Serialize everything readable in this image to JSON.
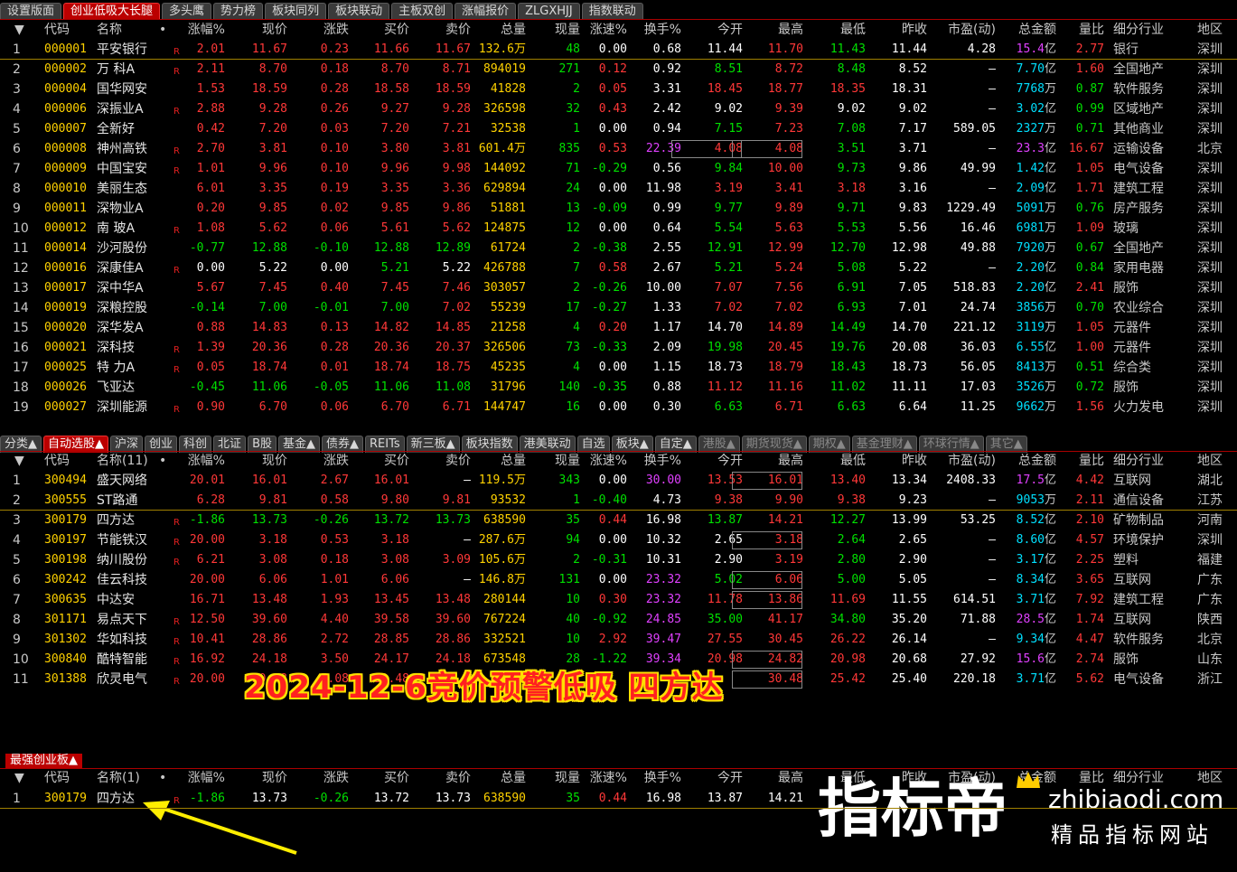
{
  "top_tabs": [
    "设置版面",
    "创业低吸大长腿",
    "多头鹰",
    "势力榜",
    "板块同列",
    "板块联动",
    "主板双创",
    "涨幅报价",
    "ZLGXHJJ",
    "指数联动"
  ],
  "top_tabs_active": 1,
  "mid_tabs": [
    "分类▲",
    "自动选股▲",
    "沪深",
    "创业",
    "科创",
    "北证",
    "B股",
    "基金▲",
    "债券▲",
    "REITs",
    "新三板▲",
    "板块指数",
    "港美联动",
    "自选",
    "板块▲",
    "自定▲",
    "港股▲",
    "期货现货▲",
    "期权▲",
    "基金理财▲",
    "环球行情▲",
    "其它▲"
  ],
  "mid_tabs_active": 1,
  "columns": {
    "sort_arrow": "▼",
    "code": "代码",
    "name": "名称",
    "name_count_2": "名称(11)",
    "name_count_3": "名称(1)",
    "dot": "•",
    "chg_pct": "涨幅%",
    "price": "现价",
    "chg": "涨跌",
    "bid": "买价",
    "ask": "卖价",
    "volume": "总量",
    "cur_vol": "现量",
    "speed": "涨速%",
    "turnover": "换手%",
    "open": "今开",
    "high": "最高",
    "low": "最低",
    "prev_close": "昨收",
    "pe": "市盈(动)",
    "amount": "总金额",
    "vol_ratio": "量比",
    "industry": "细分行业",
    "region": "地区"
  },
  "table1": [
    [
      "1",
      "000001",
      "平安银行",
      "R",
      "2.01",
      "11.67",
      "0.23",
      "11.66",
      "11.67",
      "132.6万",
      "48",
      "0.00",
      "0.68",
      "11.44",
      "11.70",
      "11.43",
      "11.44",
      "4.28",
      "15.4亿",
      "2.77",
      "银行",
      "深圳"
    ],
    [
      "2",
      "000002",
      "万 科A",
      "R",
      "2.11",
      "8.70",
      "0.18",
      "8.70",
      "8.71",
      "894019",
      "271",
      "0.12",
      "0.92",
      "8.51",
      "8.72",
      "8.48",
      "8.52",
      "–",
      "7.70亿",
      "1.60",
      "全国地产",
      "深圳"
    ],
    [
      "3",
      "000004",
      "国华网安",
      "",
      "1.53",
      "18.59",
      "0.28",
      "18.58",
      "18.59",
      "41828",
      "2",
      "0.05",
      "3.31",
      "18.45",
      "18.77",
      "18.35",
      "18.31",
      "–",
      "7768万",
      "0.87",
      "软件服务",
      "深圳"
    ],
    [
      "4",
      "000006",
      "深振业A",
      "R",
      "2.88",
      "9.28",
      "0.26",
      "9.27",
      "9.28",
      "326598",
      "32",
      "0.43",
      "2.42",
      "9.02",
      "9.39",
      "9.02",
      "9.02",
      "–",
      "3.02亿",
      "0.99",
      "区域地产",
      "深圳"
    ],
    [
      "5",
      "000007",
      "全新好",
      "",
      "0.42",
      "7.20",
      "0.03",
      "7.20",
      "7.21",
      "32538",
      "1",
      "0.00",
      "0.94",
      "7.15",
      "7.23",
      "7.08",
      "7.17",
      "589.05",
      "2327万",
      "0.71",
      "其他商业",
      "深圳"
    ],
    [
      "6",
      "000008",
      "神州高铁",
      "R",
      "2.70",
      "3.81",
      "0.10",
      "3.80",
      "3.81",
      "601.4万",
      "835",
      "0.53",
      "22.39",
      "4.08",
      "4.08",
      "3.51",
      "3.71",
      "–",
      "23.3亿",
      "16.67",
      "运输设备",
      "北京"
    ],
    [
      "7",
      "000009",
      "中国宝安",
      "R",
      "1.01",
      "9.96",
      "0.10",
      "9.96",
      "9.98",
      "144092",
      "71",
      "-0.29",
      "0.56",
      "9.84",
      "10.00",
      "9.73",
      "9.86",
      "49.99",
      "1.42亿",
      "1.05",
      "电气设备",
      "深圳"
    ],
    [
      "8",
      "000010",
      "美丽生态",
      "",
      "6.01",
      "3.35",
      "0.19",
      "3.35",
      "3.36",
      "629894",
      "24",
      "0.00",
      "11.98",
      "3.19",
      "3.41",
      "3.18",
      "3.16",
      "–",
      "2.09亿",
      "1.71",
      "建筑工程",
      "深圳"
    ],
    [
      "9",
      "000011",
      "深物业A",
      "",
      "0.20",
      "9.85",
      "0.02",
      "9.85",
      "9.86",
      "51881",
      "13",
      "-0.09",
      "0.99",
      "9.77",
      "9.89",
      "9.71",
      "9.83",
      "1229.49",
      "5091万",
      "0.76",
      "房产服务",
      "深圳"
    ],
    [
      "10",
      "000012",
      "南 玻A",
      "R",
      "1.08",
      "5.62",
      "0.06",
      "5.61",
      "5.62",
      "124875",
      "12",
      "0.00",
      "0.64",
      "5.54",
      "5.63",
      "5.53",
      "5.56",
      "16.46",
      "6981万",
      "1.09",
      "玻璃",
      "深圳"
    ],
    [
      "11",
      "000014",
      "沙河股份",
      "",
      "-0.77",
      "12.88",
      "-0.10",
      "12.88",
      "12.89",
      "61724",
      "2",
      "-0.38",
      "2.55",
      "12.91",
      "12.99",
      "12.70",
      "12.98",
      "49.88",
      "7920万",
      "0.67",
      "全国地产",
      "深圳"
    ],
    [
      "12",
      "000016",
      "深康佳A",
      "R",
      "0.00",
      "5.22",
      "0.00",
      "5.21",
      "5.22",
      "426788",
      "7",
      "0.58",
      "2.67",
      "5.21",
      "5.24",
      "5.08",
      "5.22",
      "–",
      "2.20亿",
      "0.84",
      "家用电器",
      "深圳"
    ],
    [
      "13",
      "000017",
      "深中华A",
      "",
      "5.67",
      "7.45",
      "0.40",
      "7.45",
      "7.46",
      "303057",
      "2",
      "-0.26",
      "10.00",
      "7.07",
      "7.56",
      "6.91",
      "7.05",
      "518.83",
      "2.20亿",
      "2.41",
      "服饰",
      "深圳"
    ],
    [
      "14",
      "000019",
      "深粮控股",
      "",
      "-0.14",
      "7.00",
      "-0.01",
      "7.00",
      "7.02",
      "55239",
      "17",
      "-0.27",
      "1.33",
      "7.02",
      "7.02",
      "6.93",
      "7.01",
      "24.74",
      "3856万",
      "0.70",
      "农业综合",
      "深圳"
    ],
    [
      "15",
      "000020",
      "深华发A",
      "",
      "0.88",
      "14.83",
      "0.13",
      "14.82",
      "14.85",
      "21258",
      "4",
      "0.20",
      "1.17",
      "14.70",
      "14.89",
      "14.49",
      "14.70",
      "221.12",
      "3119万",
      "1.05",
      "元器件",
      "深圳"
    ],
    [
      "16",
      "000021",
      "深科技",
      "R",
      "1.39",
      "20.36",
      "0.28",
      "20.36",
      "20.37",
      "326506",
      "73",
      "-0.33",
      "2.09",
      "19.98",
      "20.45",
      "19.76",
      "20.08",
      "36.03",
      "6.55亿",
      "1.00",
      "元器件",
      "深圳"
    ],
    [
      "17",
      "000025",
      "特 力A",
      "R",
      "0.05",
      "18.74",
      "0.01",
      "18.74",
      "18.75",
      "45235",
      "4",
      "0.00",
      "1.15",
      "18.73",
      "18.79",
      "18.43",
      "18.73",
      "56.05",
      "8413万",
      "0.51",
      "综合类",
      "深圳"
    ],
    [
      "18",
      "000026",
      "飞亚达",
      "",
      "-0.45",
      "11.06",
      "-0.05",
      "11.06",
      "11.08",
      "31796",
      "140",
      "-0.35",
      "0.88",
      "11.12",
      "11.16",
      "11.02",
      "11.11",
      "17.03",
      "3526万",
      "0.72",
      "服饰",
      "深圳"
    ],
    [
      "19",
      "000027",
      "深圳能源",
      "R",
      "0.90",
      "6.70",
      "0.06",
      "6.70",
      "6.71",
      "144747",
      "16",
      "0.00",
      "0.30",
      "6.63",
      "6.71",
      "6.63",
      "6.64",
      "11.25",
      "9662万",
      "1.56",
      "火力发电",
      "深圳"
    ]
  ],
  "table2": [
    [
      "1",
      "300494",
      "盛天网络",
      "",
      "20.01",
      "16.01",
      "2.67",
      "16.01",
      "–",
      "119.5万",
      "343",
      "0.00",
      "30.00",
      "13.53",
      "16.01",
      "13.40",
      "13.34",
      "2408.33",
      "17.5亿",
      "4.42",
      "互联网",
      "湖北"
    ],
    [
      "2",
      "300555",
      "ST路通",
      "",
      "6.28",
      "9.81",
      "0.58",
      "9.80",
      "9.81",
      "93532",
      "1",
      "-0.40",
      "4.73",
      "9.38",
      "9.90",
      "9.38",
      "9.23",
      "–",
      "9053万",
      "2.11",
      "通信设备",
      "江苏"
    ],
    [
      "3",
      "300179",
      "四方达",
      "R",
      "-1.86",
      "13.73",
      "-0.26",
      "13.72",
      "13.73",
      "638590",
      "35",
      "0.44",
      "16.98",
      "13.87",
      "14.21",
      "12.27",
      "13.99",
      "53.25",
      "8.52亿",
      "2.10",
      "矿物制品",
      "河南"
    ],
    [
      "4",
      "300197",
      "节能铁汉",
      "R",
      "20.00",
      "3.18",
      "0.53",
      "3.18",
      "–",
      "287.6万",
      "94",
      "0.00",
      "10.32",
      "2.65",
      "3.18",
      "2.64",
      "2.65",
      "–",
      "8.60亿",
      "4.57",
      "环境保护",
      "深圳"
    ],
    [
      "5",
      "300198",
      "纳川股份",
      "R",
      "6.21",
      "3.08",
      "0.18",
      "3.08",
      "3.09",
      "105.6万",
      "2",
      "-0.31",
      "10.31",
      "2.90",
      "3.19",
      "2.80",
      "2.90",
      "–",
      "3.17亿",
      "2.25",
      "塑料",
      "福建"
    ],
    [
      "6",
      "300242",
      "佳云科技",
      "",
      "20.00",
      "6.06",
      "1.01",
      "6.06",
      "–",
      "146.8万",
      "131",
      "0.00",
      "23.32",
      "5.02",
      "6.06",
      "5.00",
      "5.05",
      "–",
      "8.34亿",
      "3.65",
      "互联网",
      "广东"
    ],
    [
      "7",
      "300635",
      "中达安",
      "",
      "16.71",
      "13.48",
      "1.93",
      "13.45",
      "13.48",
      "280144",
      "10",
      "0.30",
      "23.32",
      "11.78",
      "13.86",
      "11.69",
      "11.55",
      "614.51",
      "3.71亿",
      "7.92",
      "建筑工程",
      "广东"
    ],
    [
      "8",
      "301171",
      "易点天下",
      "R",
      "12.50",
      "39.60",
      "4.40",
      "39.58",
      "39.60",
      "767224",
      "40",
      "-0.92",
      "24.85",
      "35.00",
      "41.17",
      "34.80",
      "35.20",
      "71.88",
      "28.5亿",
      "1.74",
      "互联网",
      "陕西"
    ],
    [
      "9",
      "301302",
      "华如科技",
      "R",
      "10.41",
      "28.86",
      "2.72",
      "28.85",
      "28.86",
      "332521",
      "10",
      "2.92",
      "39.47",
      "27.55",
      "30.45",
      "26.22",
      "26.14",
      "–",
      "9.34亿",
      "4.47",
      "软件服务",
      "北京"
    ],
    [
      "10",
      "300840",
      "酷特智能",
      "R",
      "16.92",
      "24.18",
      "3.50",
      "24.17",
      "24.18",
      "673548",
      "28",
      "-1.22",
      "39.34",
      "20.98",
      "24.82",
      "20.98",
      "20.68",
      "27.92",
      "15.6亿",
      "2.74",
      "服饰",
      "山东"
    ],
    [
      "11",
      "301388",
      "欣灵电气",
      "R",
      "20.00",
      "30.48",
      "5.08",
      "30.48",
      "–",
      "",
      "",
      "",
      "",
      "",
      "30.48",
      "25.42",
      "25.40",
      "220.18",
      "3.71亿",
      "5.62",
      "电气设备",
      "浙江"
    ]
  ],
  "panel3_title": "最强创业板▲",
  "table3": [
    [
      "1",
      "300179",
      "四方达",
      "R",
      "-1.86",
      "13.73",
      "-0.26",
      "13.72",
      "13.73",
      "638590",
      "35",
      "0.44",
      "16.98",
      "13.87",
      "14.21",
      "",
      "",
      "",
      "",
      "",
      "",
      ""
    ]
  ],
  "overlay_title": "2024-12-6竞价预警低吸  四方达",
  "watermark": {
    "big": "指标帝",
    "url": "zhibiaodi.com",
    "sub": "精品指标网站"
  },
  "colors": {
    "rise": "#ff3838",
    "fall": "#00e000",
    "code": "#ffd200",
    "amount": "#00e0ff",
    "turnover_high": "#e040ff",
    "active_tab": "#b00000",
    "arrow": "#ffee00"
  }
}
